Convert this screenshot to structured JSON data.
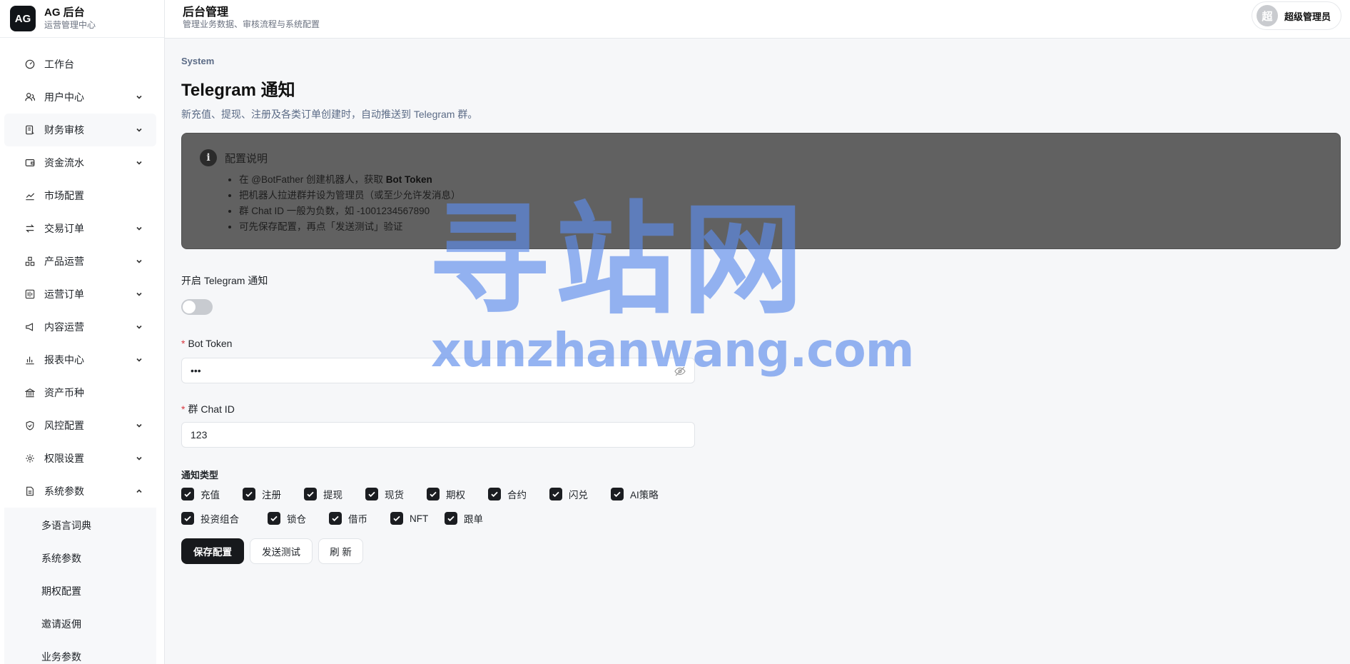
{
  "brand": {
    "logo": "AG",
    "title": "AG 后台",
    "subtitle": "运营管理中心"
  },
  "header": {
    "title": "后台管理",
    "subtitle": "管理业务数据、审核流程与系统配置"
  },
  "user": {
    "avatar_text": "超",
    "name": "超级管理员"
  },
  "sidebar": {
    "items": [
      {
        "label": "工作台",
        "icon": "dashboard-icon",
        "expandable": false
      },
      {
        "label": "用户中心",
        "icon": "users-icon",
        "expandable": true
      },
      {
        "label": "财务审核",
        "icon": "finance-audit-icon",
        "expandable": true
      },
      {
        "label": "资金流水",
        "icon": "wallet-icon",
        "expandable": true
      },
      {
        "label": "市场配置",
        "icon": "market-icon",
        "expandable": false
      },
      {
        "label": "交易订单",
        "icon": "exchange-icon",
        "expandable": true
      },
      {
        "label": "产品运营",
        "icon": "product-icon",
        "expandable": true
      },
      {
        "label": "运营订单",
        "icon": "ops-order-icon",
        "expandable": true
      },
      {
        "label": "内容运营",
        "icon": "megaphone-icon",
        "expandable": true
      },
      {
        "label": "报表中心",
        "icon": "report-icon",
        "expandable": true
      },
      {
        "label": "资产币种",
        "icon": "bank-icon",
        "expandable": false
      },
      {
        "label": "风控配置",
        "icon": "shield-icon",
        "expandable": true
      },
      {
        "label": "权限设置",
        "icon": "gear-icon",
        "expandable": true
      },
      {
        "label": "系统参数",
        "icon": "document-icon",
        "expandable": true,
        "expanded": true
      }
    ],
    "subitems": [
      "多语言词典",
      "系统参数",
      "期权配置",
      "邀请返佣",
      "业务参数"
    ]
  },
  "page": {
    "breadcrumb": "System",
    "title": "Telegram 通知",
    "description": "新充值、提现、注册及各类订单创建时，自动推送到 Telegram 群。"
  },
  "info": {
    "title": "配置说明",
    "line1_prefix": "在 @BotFather 创建机器人，获取 ",
    "line1_bold": "Bot Token",
    "line2": "把机器人拉进群并设为管理员（或至少允许发消息）",
    "line3": "群 Chat ID 一般为负数，如 -1001234567890",
    "line4": "可先保存配置，再点「发送测试」验证"
  },
  "form": {
    "enable_label": "开启 Telegram 通知",
    "enabled": false,
    "bot_token_label": "Bot Token",
    "bot_token_value": "•••",
    "chat_id_label": "群 Chat ID",
    "chat_id_value": "123",
    "notify_types_label": "通知类型",
    "types_row1": [
      "充值",
      "注册",
      "提现",
      "现货",
      "期权",
      "合约",
      "闪兑",
      "AI策略"
    ],
    "types_row2": [
      "投资组合",
      "锁仓",
      "借币",
      "NFT",
      "跟单"
    ]
  },
  "buttons": {
    "save": "保存配置",
    "test": "发送测试",
    "refresh": "刷 新"
  },
  "watermark": {
    "cn": "寻站网",
    "en": "xunzhanwang.com"
  },
  "colors": {
    "primary": "#17191c",
    "info_box": "#616161",
    "watermark": "#5c8ceb",
    "required": "#d9363e"
  }
}
